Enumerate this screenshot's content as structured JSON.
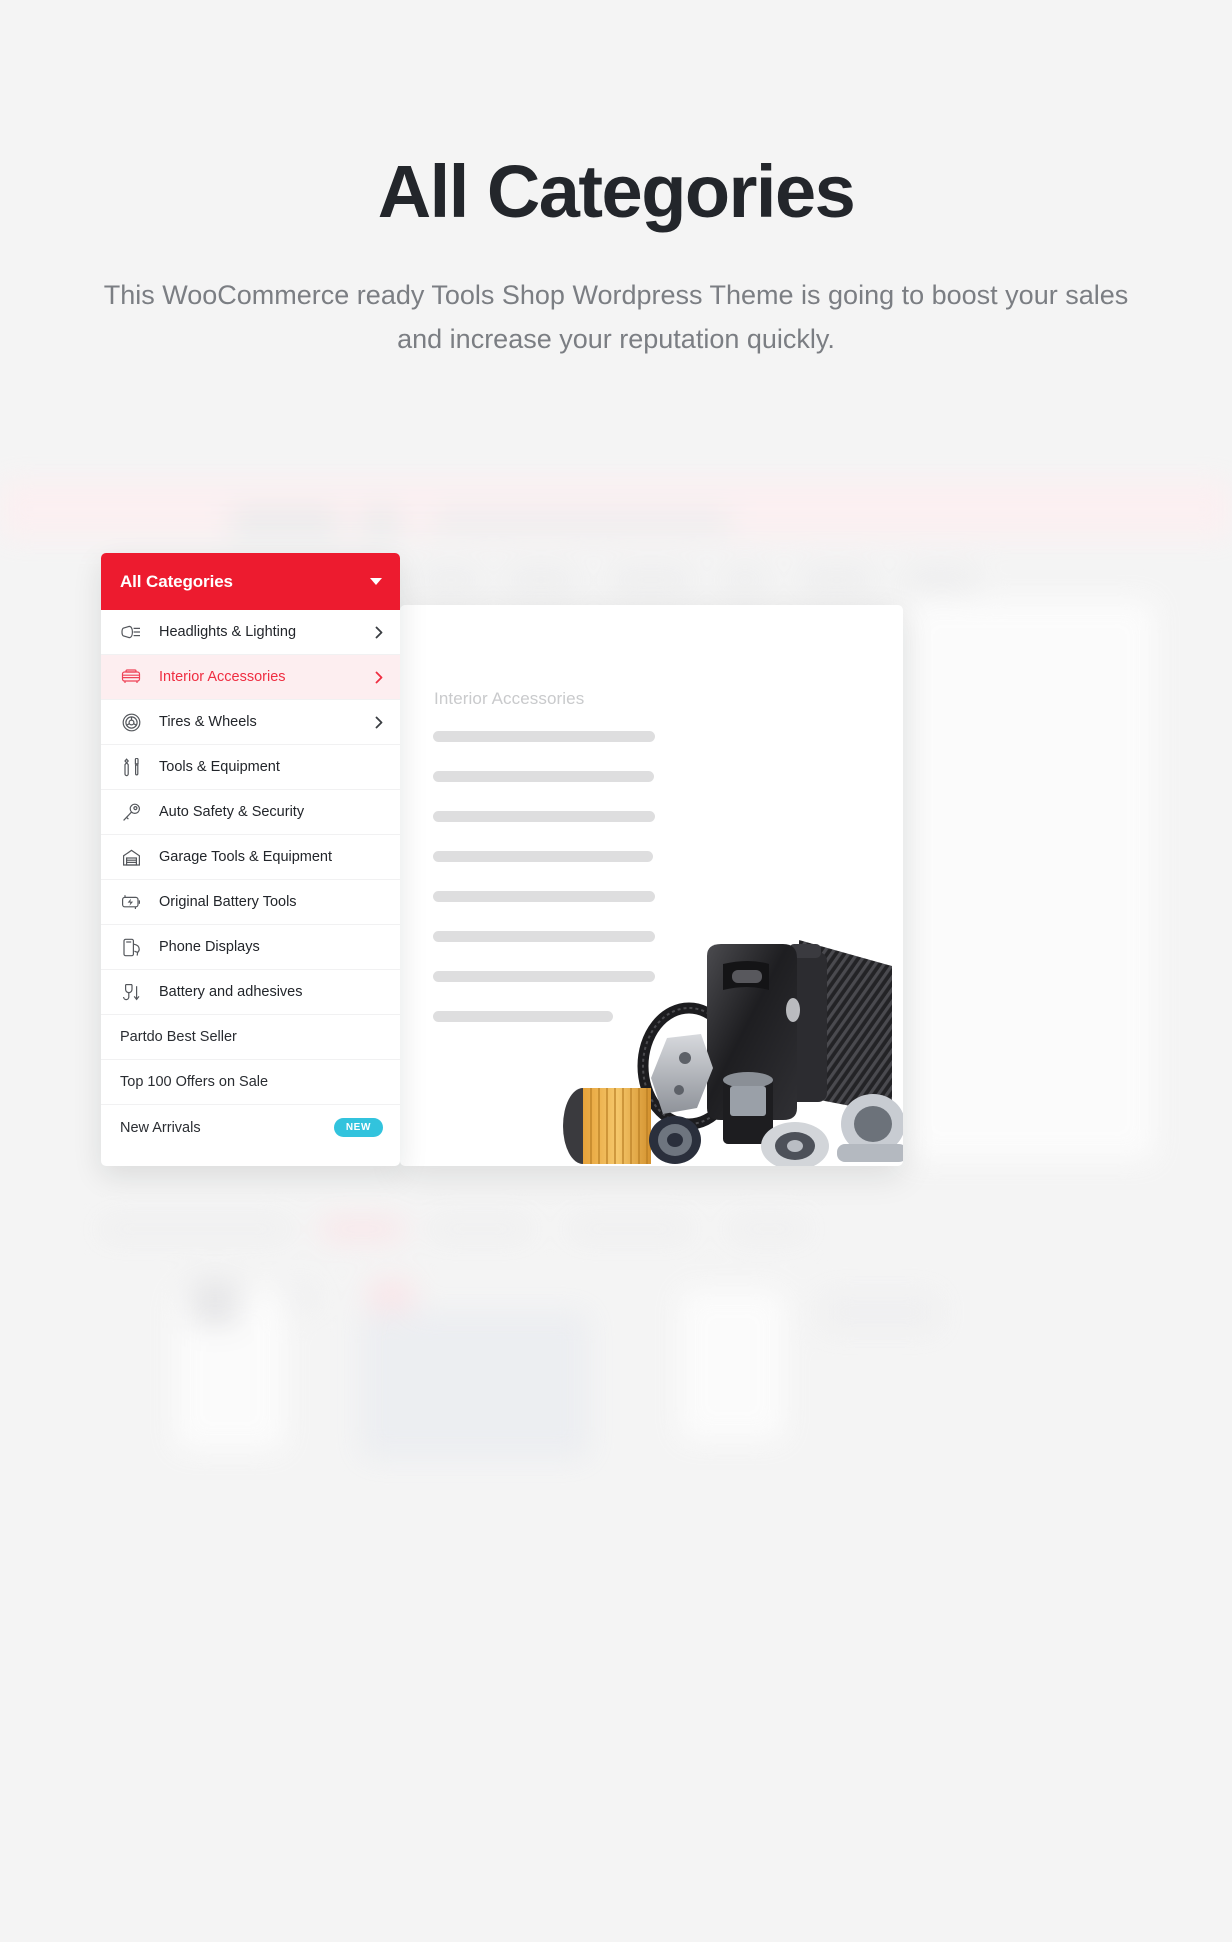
{
  "hero": {
    "title": "All Categories",
    "subtitle": "This WooCommerce ready Tools Shop Wordpress Theme is going to boost your sales and increase your reputation quickly."
  },
  "menu": {
    "header_label": "All Categories",
    "header_icon": "chevron-down-icon",
    "header_bg": "#ed1b2f",
    "items": [
      {
        "label": "Headlights & Lighting",
        "icon": "headlight-icon",
        "has_submenu": true,
        "active": false
      },
      {
        "label": "Interior Accessories",
        "icon": "car-seat-icon",
        "has_submenu": true,
        "active": true
      },
      {
        "label": "Tires & Wheels",
        "icon": "wheel-icon",
        "has_submenu": true,
        "active": false
      },
      {
        "label": "Tools & Equipment",
        "icon": "wrench-screwdriver-icon",
        "has_submenu": false,
        "active": false
      },
      {
        "label": "Auto Safety & Security",
        "icon": "key-icon",
        "has_submenu": false,
        "active": false
      },
      {
        "label": "Garage Tools & Equipment",
        "icon": "garage-icon",
        "has_submenu": false,
        "active": false
      },
      {
        "label": "Original Battery Tools",
        "icon": "battery-bolt-icon",
        "has_submenu": false,
        "active": false
      },
      {
        "label": "Phone Displays",
        "icon": "phone-display-icon",
        "has_submenu": false,
        "active": false
      },
      {
        "label": "Battery and adhesives",
        "icon": "battery-adhesive-icon",
        "has_submenu": false,
        "active": false
      }
    ],
    "links": [
      {
        "label": "Partdo Best Seller",
        "badge": null
      },
      {
        "label": "Top 100 Offers on Sale",
        "badge": null
      },
      {
        "label": "New Arrivals",
        "badge": "NEW"
      }
    ],
    "badge_color": "#32c3dd",
    "active_color": "#ef2d41"
  },
  "panel": {
    "title": "Interior Accessories",
    "placeholder_bar_widths": [
      222,
      221,
      222,
      220,
      222,
      222,
      222,
      180
    ]
  }
}
